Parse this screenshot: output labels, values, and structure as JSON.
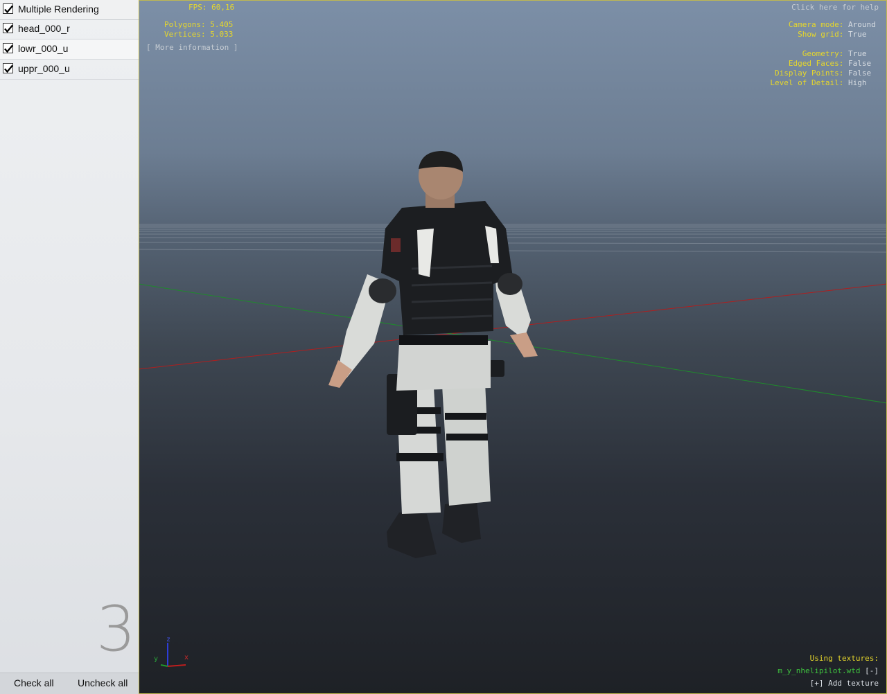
{
  "sidebar": {
    "header": {
      "label": "Multiple Rendering",
      "checked": true
    },
    "items": [
      {
        "label": "head_000_r",
        "checked": true
      },
      {
        "label": "lowr_000_u",
        "checked": true
      },
      {
        "label": "uppr_000_u",
        "checked": true
      }
    ],
    "count": "3",
    "check_all_label": "Check all",
    "uncheck_all_label": "Uncheck all"
  },
  "viewport": {
    "stats": {
      "fps_label": "FPS:",
      "fps_value": "60,16",
      "polygons_label": "Polygons:",
      "polygons_value": "5.405",
      "vertices_label": "Vertices:",
      "vertices_value": "5.033",
      "more_info": "[ More information ]"
    },
    "help_link": "Click here for help",
    "settings": [
      {
        "label": "Camera mode:",
        "value": "Around"
      },
      {
        "label": "Show grid:",
        "value": "True"
      },
      {
        "label": "Geometry:",
        "value": "True"
      },
      {
        "label": "Edged Faces:",
        "value": "False"
      },
      {
        "label": "Display Points:",
        "value": "False"
      },
      {
        "label": "Level of Detail:",
        "value": "High"
      }
    ],
    "textures": {
      "heading": "Using textures:",
      "file": "m_y_nhelipilot.wtd",
      "remove": "[-]",
      "add": "[+] Add texture"
    },
    "axes": {
      "x": "x",
      "y": "y",
      "z": "z"
    },
    "colors": {
      "hud_yellow": "#e6d72c",
      "texture_green": "#3fc23f",
      "x_axis": "#b01e1e",
      "z_axis": "#1f8a2c"
    }
  }
}
